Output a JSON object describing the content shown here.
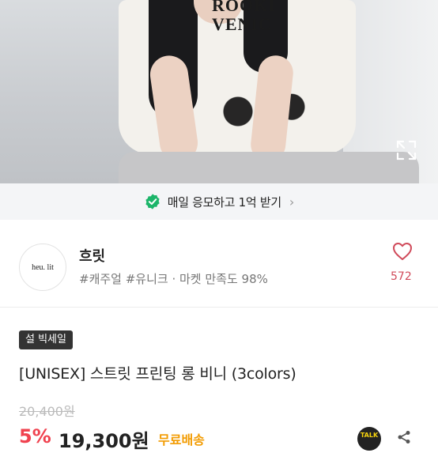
{
  "hero": {
    "print_line1": "ROOKI",
    "print_line2": "VENIC",
    "expand_icon": "expand-icon"
  },
  "promo": {
    "icon": "check-badge-icon",
    "text": "매일 응모하고 1억 받기",
    "chevron": "›",
    "accent": "#1cb56a"
  },
  "shop": {
    "logo_text": "heu. lit",
    "name": "흐릿",
    "tags": "#캐주얼 #유니크 · 마켓 만족도 98%",
    "likes": "572",
    "heart_color": "#d04a5a"
  },
  "product": {
    "badge": "설 빅세일",
    "title": "[UNISEX] 스트릿 프린팅 롱 비니 (3colors)",
    "original_price": "20,400원",
    "discount": "5%",
    "price": "19,300원",
    "shipping": "무료배송",
    "talk_label": "TALK",
    "discount_color": "#f0424f",
    "shipping_color": "#f29b00"
  }
}
